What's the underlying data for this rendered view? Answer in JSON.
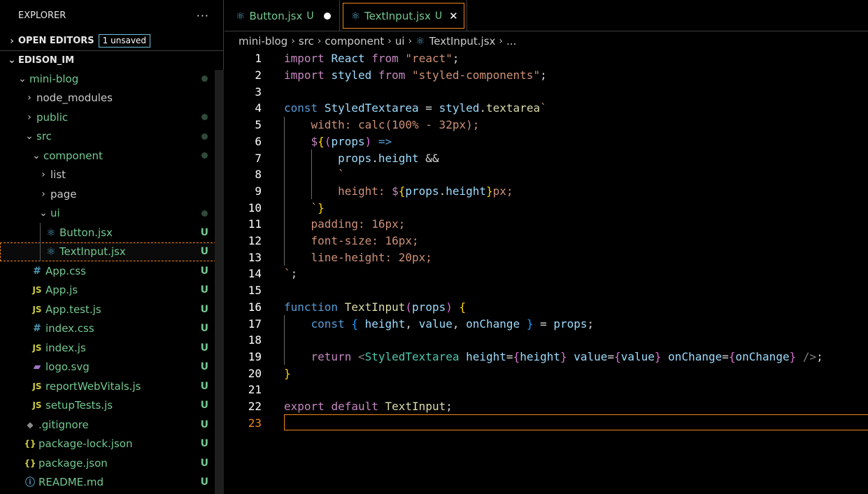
{
  "sidebar": {
    "title": "EXPLORER",
    "more": "···",
    "open_editors": "OPEN EDITORS",
    "unsaved_badge": "1 unsaved",
    "root": "EDISON_IM",
    "tree": [
      {
        "name": "mini-blog",
        "kind": "folder-open",
        "depth": 1,
        "mark": "dot",
        "green": true
      },
      {
        "name": "node_modules",
        "kind": "folder",
        "depth": 2,
        "mark": "",
        "green": false
      },
      {
        "name": "public",
        "kind": "folder",
        "depth": 2,
        "mark": "dot",
        "green": true
      },
      {
        "name": "src",
        "kind": "folder-open",
        "depth": 2,
        "mark": "dot",
        "green": true
      },
      {
        "name": "component",
        "kind": "folder-open",
        "depth": 3,
        "mark": "dot",
        "green": true
      },
      {
        "name": "list",
        "kind": "folder",
        "depth": 4,
        "mark": "",
        "green": false
      },
      {
        "name": "page",
        "kind": "folder",
        "depth": 4,
        "mark": "",
        "green": false
      },
      {
        "name": "ui",
        "kind": "folder-open",
        "depth": 4,
        "mark": "dot",
        "green": true
      },
      {
        "name": "Button.jsx",
        "kind": "react",
        "depth": 5,
        "mark": "U",
        "green": true
      },
      {
        "name": "TextInput.jsx",
        "kind": "react",
        "depth": 5,
        "mark": "U",
        "green": true,
        "selected": true
      },
      {
        "name": "App.css",
        "kind": "css",
        "depth": 3,
        "mark": "U",
        "green": true
      },
      {
        "name": "App.js",
        "kind": "js",
        "depth": 3,
        "mark": "U",
        "green": true
      },
      {
        "name": "App.test.js",
        "kind": "js",
        "depth": 3,
        "mark": "U",
        "green": true
      },
      {
        "name": "index.css",
        "kind": "css",
        "depth": 3,
        "mark": "U",
        "green": true
      },
      {
        "name": "index.js",
        "kind": "js",
        "depth": 3,
        "mark": "U",
        "green": true
      },
      {
        "name": "logo.svg",
        "kind": "svg",
        "depth": 3,
        "mark": "U",
        "green": true
      },
      {
        "name": "reportWebVitals.js",
        "kind": "js",
        "depth": 3,
        "mark": "U",
        "green": true
      },
      {
        "name": "setupTests.js",
        "kind": "js",
        "depth": 3,
        "mark": "U",
        "green": true
      },
      {
        "name": ".gitignore",
        "kind": "git",
        "depth": 2,
        "mark": "U",
        "green": true
      },
      {
        "name": "package-lock.json",
        "kind": "json",
        "depth": 2,
        "mark": "U",
        "green": true
      },
      {
        "name": "package.json",
        "kind": "json",
        "depth": 2,
        "mark": "U",
        "green": true
      },
      {
        "name": "README.md",
        "kind": "info",
        "depth": 2,
        "mark": "U",
        "green": true
      }
    ]
  },
  "tabs": [
    {
      "label": "Button.jsx",
      "flag": "U",
      "unsaved": true,
      "active": false
    },
    {
      "label": "TextInput.jsx",
      "flag": "U",
      "unsaved": false,
      "active": true
    }
  ],
  "breadcrumb": [
    "mini-blog",
    "src",
    "component",
    "ui",
    "TextInput.jsx",
    "..."
  ],
  "editor": {
    "current_line": 23,
    "lines": [
      [
        [
          "k",
          "import"
        ],
        [
          "w",
          " "
        ],
        [
          "v",
          "React"
        ],
        [
          "w",
          " "
        ],
        [
          "k",
          "from"
        ],
        [
          "w",
          " "
        ],
        [
          "s",
          "\"react\""
        ],
        [
          "w",
          ";"
        ]
      ],
      [
        [
          "k",
          "import"
        ],
        [
          "w",
          " "
        ],
        [
          "v",
          "styled"
        ],
        [
          "w",
          " "
        ],
        [
          "k",
          "from"
        ],
        [
          "w",
          " "
        ],
        [
          "s",
          "\"styled-components\""
        ],
        [
          "w",
          ";"
        ]
      ],
      [],
      [
        [
          "b",
          "const"
        ],
        [
          "w",
          " "
        ],
        [
          "v",
          "StyledTextarea"
        ],
        [
          "w",
          " = "
        ],
        [
          "v",
          "styled"
        ],
        [
          "w",
          "."
        ],
        [
          "f",
          "textarea"
        ],
        [
          "s",
          "`"
        ]
      ],
      [
        [
          "w",
          "    "
        ],
        [
          "css",
          "width: calc(100% - 32px);"
        ]
      ],
      [
        [
          "w",
          "    "
        ],
        [
          "k",
          "$"
        ],
        [
          "y",
          "{"
        ],
        [
          "p",
          "("
        ],
        [
          "v",
          "props"
        ],
        [
          "p",
          ")"
        ],
        [
          "w",
          " "
        ],
        [
          "b",
          "=>"
        ]
      ],
      [
        [
          "w",
          "        "
        ],
        [
          "v",
          "props"
        ],
        [
          "w",
          "."
        ],
        [
          "v",
          "height"
        ],
        [
          "w",
          " &&"
        ]
      ],
      [
        [
          "w",
          "        "
        ],
        [
          "s",
          "`"
        ]
      ],
      [
        [
          "w",
          "        "
        ],
        [
          "css",
          "height: "
        ],
        [
          "k",
          "$"
        ],
        [
          "y",
          "{"
        ],
        [
          "v",
          "props"
        ],
        [
          "w",
          "."
        ],
        [
          "v",
          "height"
        ],
        [
          "y",
          "}"
        ],
        [
          "css",
          "px;"
        ]
      ],
      [
        [
          "w",
          "    "
        ],
        [
          "s",
          "`"
        ],
        [
          "y",
          "}"
        ]
      ],
      [
        [
          "w",
          "    "
        ],
        [
          "css",
          "padding: 16px;"
        ]
      ],
      [
        [
          "w",
          "    "
        ],
        [
          "css",
          "font-size: 16px;"
        ]
      ],
      [
        [
          "w",
          "    "
        ],
        [
          "css",
          "line-height: 20px;"
        ]
      ],
      [
        [
          "s",
          "`"
        ],
        [
          "w",
          ";"
        ]
      ],
      [],
      [
        [
          "b",
          "function"
        ],
        [
          "w",
          " "
        ],
        [
          "f",
          "TextInput"
        ],
        [
          "p",
          "("
        ],
        [
          "v",
          "props"
        ],
        [
          "p",
          ")"
        ],
        [
          "w",
          " "
        ],
        [
          "y",
          "{"
        ]
      ],
      [
        [
          "w",
          "    "
        ],
        [
          "b",
          "const"
        ],
        [
          "w",
          " "
        ],
        [
          "c",
          "{"
        ],
        [
          "w",
          " "
        ],
        [
          "v",
          "height"
        ],
        [
          "w",
          ", "
        ],
        [
          "v",
          "value"
        ],
        [
          "w",
          ", "
        ],
        [
          "v",
          "onChange"
        ],
        [
          "w",
          " "
        ],
        [
          "c",
          "}"
        ],
        [
          "w",
          " = "
        ],
        [
          "v",
          "props"
        ],
        [
          "w",
          ";"
        ]
      ],
      [],
      [
        [
          "w",
          "    "
        ],
        [
          "k",
          "return"
        ],
        [
          "w",
          " "
        ],
        [
          "o",
          "<"
        ],
        [
          "t",
          "StyledTextarea"
        ],
        [
          "w",
          " "
        ],
        [
          "v",
          "height"
        ],
        [
          "w",
          "="
        ],
        [
          "p",
          "{"
        ],
        [
          "v",
          "height"
        ],
        [
          "p",
          "}"
        ],
        [
          "w",
          " "
        ],
        [
          "v",
          "value"
        ],
        [
          "w",
          "="
        ],
        [
          "p",
          "{"
        ],
        [
          "v",
          "value"
        ],
        [
          "p",
          "}"
        ],
        [
          "w",
          " "
        ],
        [
          "v",
          "onChange"
        ],
        [
          "w",
          "="
        ],
        [
          "p",
          "{"
        ],
        [
          "v",
          "onChange"
        ],
        [
          "p",
          "}"
        ],
        [
          "w",
          " "
        ],
        [
          "o",
          "/>"
        ],
        [
          "w",
          ";"
        ]
      ],
      [
        [
          "y",
          "}"
        ]
      ],
      [],
      [
        [
          "k",
          "export"
        ],
        [
          "w",
          " "
        ],
        [
          "k",
          "default"
        ],
        [
          "w",
          " "
        ],
        [
          "f",
          "TextInput"
        ],
        [
          "w",
          ";"
        ]
      ],
      []
    ]
  }
}
